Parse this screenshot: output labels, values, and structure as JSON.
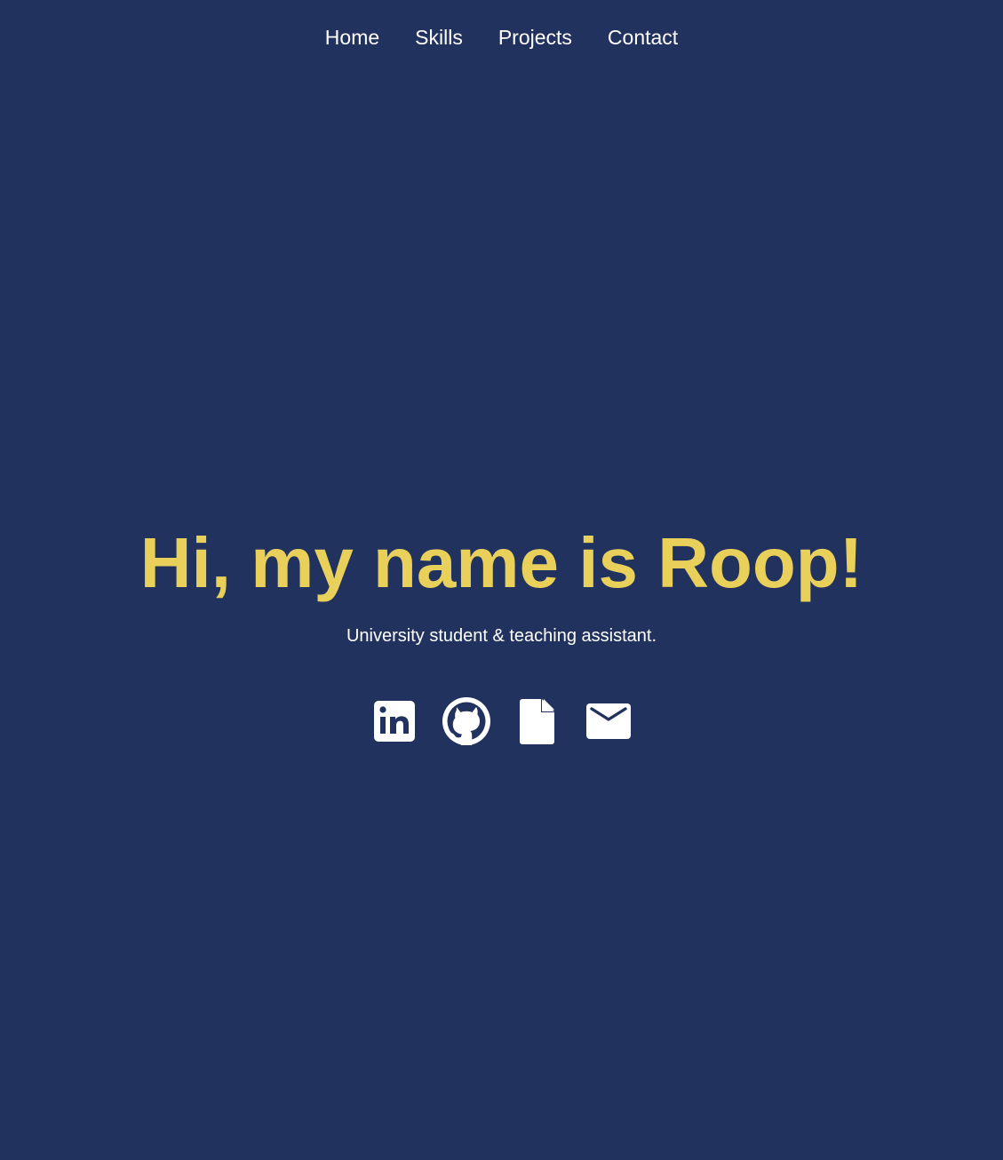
{
  "nav": {
    "items": [
      {
        "label": "Home"
      },
      {
        "label": "Skills"
      },
      {
        "label": "Projects"
      },
      {
        "label": "Contact"
      }
    ]
  },
  "hero": {
    "title": "Hi, my name is Roop!",
    "subtitle": "University student & teaching assistant."
  },
  "social": {
    "icons": [
      "linkedin-icon",
      "github-icon",
      "document-icon",
      "mail-icon"
    ]
  },
  "colors": {
    "background": "#22325e",
    "accent": "#e8d05b",
    "text": "#ffffff"
  }
}
